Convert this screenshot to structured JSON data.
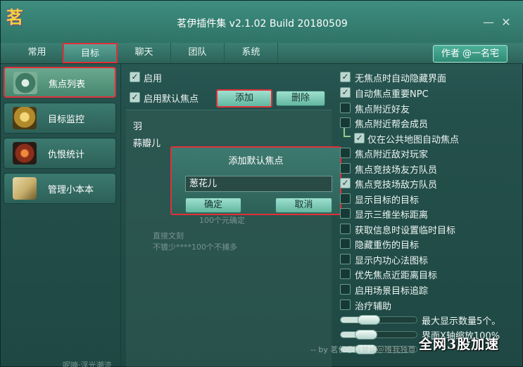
{
  "window": {
    "logo_char": "茗",
    "title": "茗伊插件集 v2.1.02 Build 20180509",
    "minimize_glyph": "—",
    "close_glyph": "✕"
  },
  "tabs": [
    {
      "label": "常用"
    },
    {
      "label": "目标"
    },
    {
      "label": "聊天"
    },
    {
      "label": "团队"
    },
    {
      "label": "系统"
    }
  ],
  "author_button": "作者 @一名宅",
  "sidebar": {
    "items": [
      {
        "label": "焦点列表",
        "icon": "eye-book-icon"
      },
      {
        "label": "目标监控",
        "icon": "golden-emblem-icon"
      },
      {
        "label": "仇恨统计",
        "icon": "flame-warrior-icon"
      },
      {
        "label": "管理小本本",
        "icon": "open-book-icon"
      }
    ]
  },
  "middle": {
    "enable_label": "启用",
    "enable_checked": true,
    "default_focus_label": "启用默认焦点",
    "default_focus_checked": true,
    "add_button": "添加",
    "delete_button": "删除",
    "list_items": [
      "羽",
      "蒜瓣儿"
    ],
    "faded_lines": [
      "100个元确定",
      "直接文刻",
      "不镀少****100个不捕多"
    ]
  },
  "dialog": {
    "title": "添加默认焦点",
    "input_value": "葱花儿",
    "confirm_button": "确定",
    "cancel_button": "取消"
  },
  "options": [
    {
      "label": "无焦点时自动隐藏界面",
      "checked": true
    },
    {
      "label": "自动焦点重要NPC",
      "checked": true
    },
    {
      "label": "焦点附近好友",
      "checked": false
    },
    {
      "label": "焦点附近帮会成员",
      "checked": false
    },
    {
      "label": "仅在公共地图自动焦点",
      "checked": true
    },
    {
      "label": "焦点附近敌对玩家",
      "checked": false
    },
    {
      "label": "焦点竞技场友方队员",
      "checked": false
    },
    {
      "label": "焦点竞技场敌方队员",
      "checked": true
    },
    {
      "label": "显示目标的目标",
      "checked": false
    },
    {
      "label": "显示三维坐标距离",
      "checked": false
    },
    {
      "label": "获取信息时设置临时目标",
      "checked": false
    },
    {
      "label": "隐藏重伤的目标",
      "checked": false
    },
    {
      "label": "显示内功心法图标",
      "checked": false
    },
    {
      "label": "优先焦点近距离目标",
      "checked": false
    },
    {
      "label": "启用场景目标追踪",
      "checked": false
    },
    {
      "label": "治疗辅助",
      "checked": false
    }
  ],
  "sliders": [
    {
      "label": "最大显示数量5个。",
      "level": 0.35
    },
    {
      "label": "界面X轴缩放100%",
      "level": 0.25
    },
    {
      "label": "",
      "level": 0.2
    }
  ],
  "footer": "-- by 茗伊＠双梦镇＠唯我独尊",
  "watermark": "全网3股加速",
  "bottom_left": "呢喃·浮光潮流"
}
